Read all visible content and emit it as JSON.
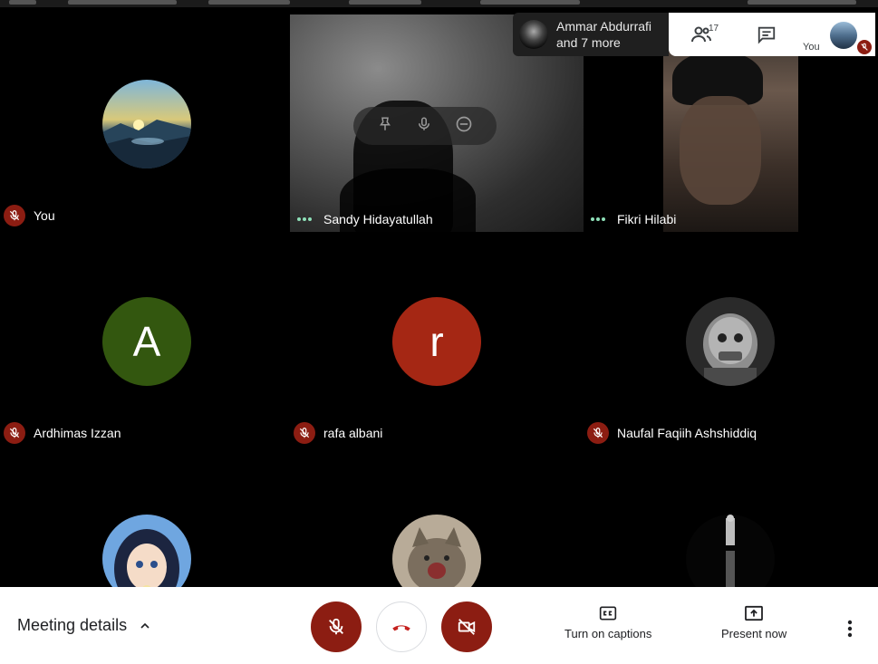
{
  "tiles": [
    {
      "name": "You",
      "status": "muted",
      "avatar": {
        "kind": "landscape"
      }
    },
    {
      "name": "Sandy Hidayatullah",
      "status": "speaking",
      "avatar": {
        "kind": "video"
      }
    },
    {
      "name": "Fikri Hilabi",
      "status": "speaking",
      "avatar": {
        "kind": "video"
      }
    },
    {
      "name": "Ardhimas Izzan",
      "status": "muted",
      "avatar": {
        "kind": "letter",
        "letter": "A",
        "color": "#33570f"
      }
    },
    {
      "name": "rafa albani",
      "status": "muted",
      "avatar": {
        "kind": "letter",
        "letter": "r",
        "color": "#a52714"
      }
    },
    {
      "name": "Naufal Faqiih Ashshiddiq",
      "status": "muted",
      "avatar": {
        "kind": "robot"
      }
    },
    {
      "name": "",
      "status": "none",
      "avatar": {
        "kind": "anime"
      }
    },
    {
      "name": "",
      "status": "none",
      "avatar": {
        "kind": "kitten"
      }
    },
    {
      "name": "",
      "status": "none",
      "avatar": {
        "kind": "figure"
      }
    }
  ],
  "tile_hover_controls": {
    "icons": [
      "pin-icon",
      "mic-icon",
      "remove-icon"
    ]
  },
  "presenter": {
    "line1": "Ammar Abdurrafi",
    "line2": "and 7 more"
  },
  "right_panel": {
    "people_count": "17",
    "self_label": "You"
  },
  "bottom_bar": {
    "meeting_details_label": "Meeting details",
    "captions_label": "Turn on captions",
    "present_label": "Present now"
  },
  "colors": {
    "muted_red": "#8c1d12",
    "speaking_green": "#8ee0b8",
    "end_call_red": "#c5221f"
  }
}
